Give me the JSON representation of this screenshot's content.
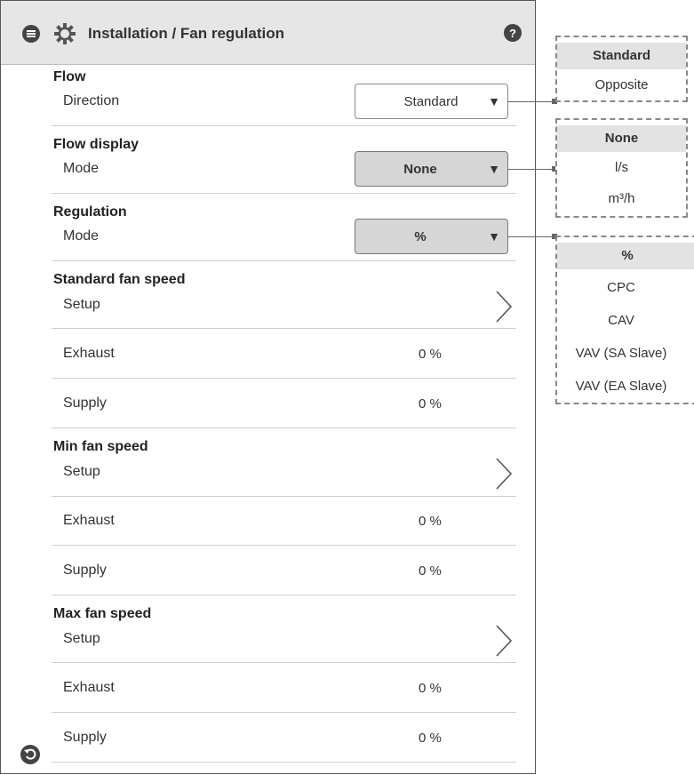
{
  "header": {
    "title": "Installation / Fan regulation",
    "menu_icon": "menu-icon",
    "settings_icon": "gear-icon",
    "help_icon": "help-icon"
  },
  "flow": {
    "title": "Flow",
    "direction_label": "Direction",
    "direction_value": "Standard"
  },
  "flow_display": {
    "title": "Flow display",
    "mode_label": "Mode",
    "mode_value": "None"
  },
  "regulation": {
    "title": "Regulation",
    "mode_label": "Mode",
    "mode_value": "%"
  },
  "standard_fan_speed": {
    "title": "Standard fan speed",
    "setup_label": "Setup",
    "exhaust_label": "Exhaust",
    "exhaust_value": "0 %",
    "supply_label": "Supply",
    "supply_value": "0 %"
  },
  "min_fan_speed": {
    "title": "Min fan speed",
    "setup_label": "Setup",
    "exhaust_label": "Exhaust",
    "exhaust_value": "0 %",
    "supply_label": "Supply",
    "supply_value": "0 %"
  },
  "max_fan_speed": {
    "title": "Max fan speed",
    "setup_label": "Setup",
    "exhaust_label": "Exhaust",
    "exhaust_value": "0 %",
    "supply_label": "Supply",
    "supply_value": "0 %"
  },
  "dropdown_arrow": "▼",
  "popups": {
    "direction": {
      "selected": "Standard",
      "options": [
        "Opposite"
      ]
    },
    "flow_display": {
      "selected": "None",
      "options": [
        "l/s",
        "m³/h"
      ]
    },
    "regulation": {
      "selected": "%",
      "options": [
        "CPC",
        "CAV",
        "VAV (SA Slave)",
        "VAV (EA Slave)"
      ]
    }
  },
  "footer": {
    "back_icon": "back-icon"
  }
}
